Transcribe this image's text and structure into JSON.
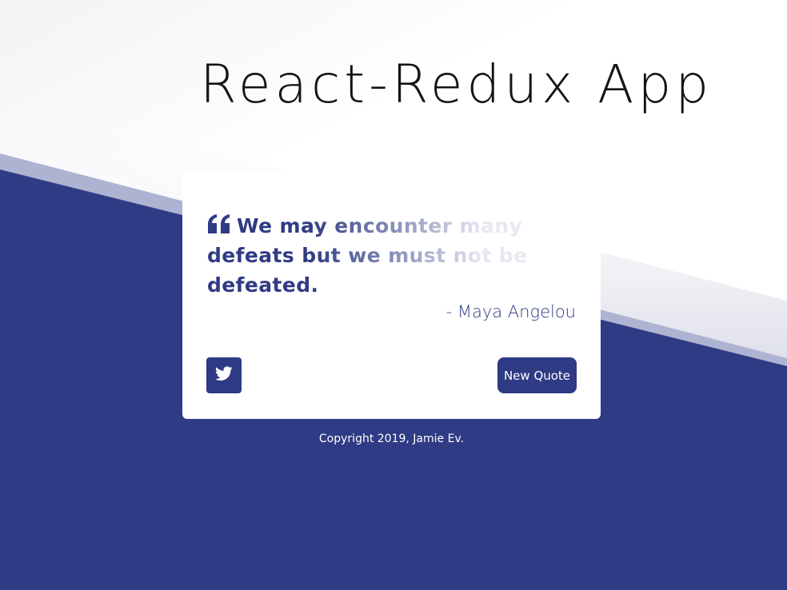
{
  "app": {
    "title": "React-Redux App"
  },
  "quote": {
    "line1": "We may encounter many",
    "line2": "defeats but we must not be",
    "line3": "defeated.",
    "author": "- Maya Angelou"
  },
  "actions": {
    "tweet_icon": "twitter-icon",
    "new_quote_label": "New Quote"
  },
  "footer": {
    "copyright": "Copyright 2019, Jamie Ev."
  },
  "colors": {
    "accent": "#2f3b84",
    "band": "#aeb3d2",
    "background": "#ffffff"
  }
}
